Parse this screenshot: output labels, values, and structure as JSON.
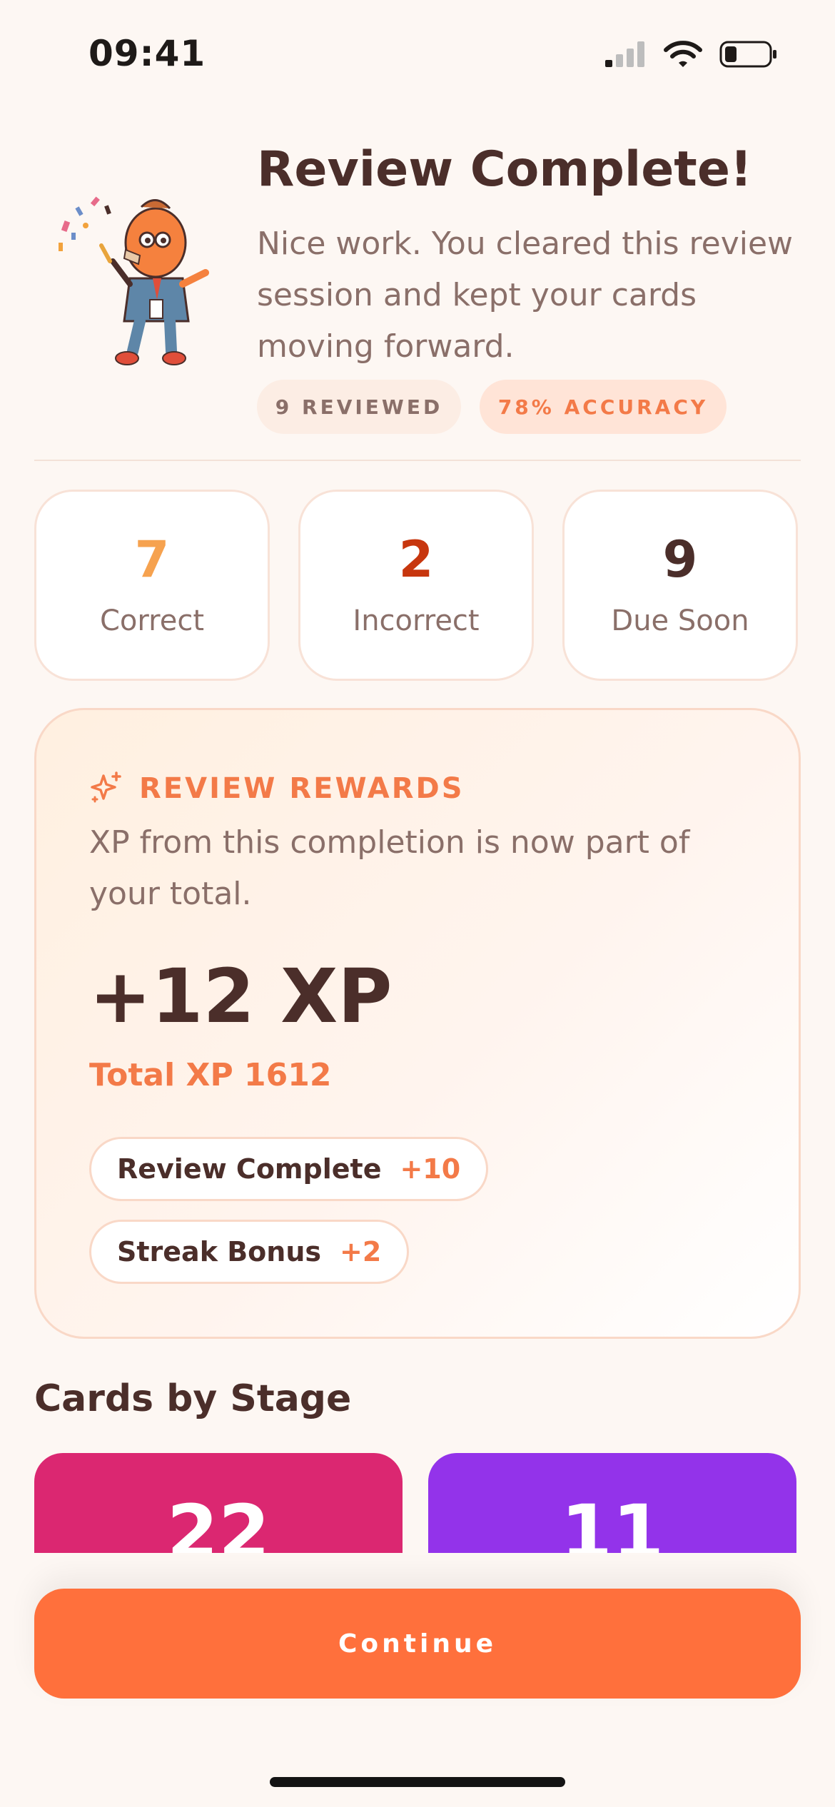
{
  "status_bar": {
    "time": "09:41",
    "icons": [
      "cellular-signal-icon",
      "wifi-icon",
      "battery-icon"
    ]
  },
  "header": {
    "title": "Review Complete!",
    "subtitle": "Nice work. You cleared this review session and kept your cards moving forward.",
    "mascot": "celebrating-mascot-illustration",
    "pills": {
      "reviewed": "9 REVIEWED",
      "accuracy": "78% ACCURACY"
    }
  },
  "stats": [
    {
      "value": "7",
      "label": "Correct",
      "color": "#F6A24F"
    },
    {
      "value": "2",
      "label": "Incorrect",
      "color": "#C7360E"
    },
    {
      "value": "9",
      "label": "Due Soon",
      "color": "#4B2E2A"
    }
  ],
  "rewards": {
    "icon": "sparkles-icon",
    "title": "REVIEW REWARDS",
    "description": "XP from this completion is now part of your total.",
    "xp_gained": "+12 XP",
    "total_xp": "Total XP 1612",
    "breakdown": [
      {
        "label": "Review Complete",
        "points": "+10"
      },
      {
        "label": "Streak Bonus",
        "points": "+2"
      }
    ]
  },
  "stages": {
    "title": "Cards by Stage",
    "cards": [
      {
        "value": "22",
        "color": "#DB2771"
      },
      {
        "value": "11",
        "color": "#9333EA"
      }
    ]
  },
  "footer": {
    "continue_label": "Continue"
  },
  "colors": {
    "background": "#FDF7F3",
    "accent": "#FF703C",
    "text": "#4B2E2A",
    "muted": "#8A6F69"
  }
}
